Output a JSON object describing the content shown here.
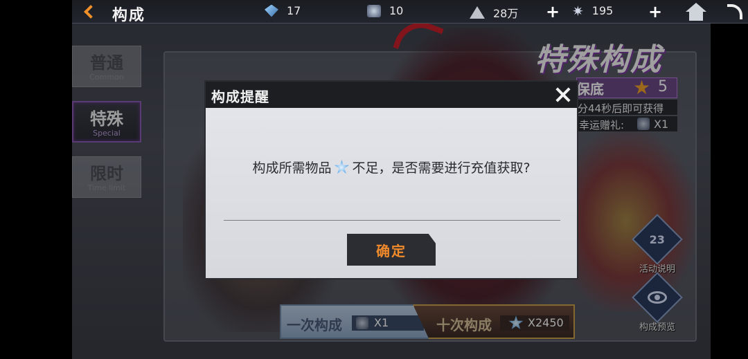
{
  "header": {
    "title": "构成",
    "resources": [
      {
        "icon": "gem-icon",
        "value": "17"
      },
      {
        "icon": "core-icon",
        "value": "10"
      },
      {
        "icon": "triangle-currency-icon",
        "value": "28万"
      },
      {
        "icon": "star-crystal-icon",
        "value": "195"
      }
    ]
  },
  "tabs": [
    {
      "zh": "普通",
      "en": "Common",
      "active": false
    },
    {
      "zh": "特殊",
      "en": "Special",
      "active": true
    },
    {
      "zh": "限时",
      "en": "Time limit",
      "active": false
    }
  ],
  "banner": {
    "title": "特殊构成",
    "pity_label": "保底",
    "pity_count": "5",
    "timer": "分44秒后即可获得",
    "gift_label": "幸运赠礼:",
    "gift_count": "X1"
  },
  "side_buttons": {
    "event_info": {
      "icon_text": "23",
      "label": "活动说明"
    },
    "preview": {
      "label": "构成预览"
    }
  },
  "pulls": {
    "single": {
      "label": "一次构成",
      "cost": "X1"
    },
    "ten": {
      "label": "十次构成",
      "cost": "X2450"
    }
  },
  "dialog": {
    "title": "构成提醒",
    "message_before": "构成所需物品",
    "message_after": "不足，是否需要进行充值获取?",
    "confirm_label": "确定"
  },
  "colors": {
    "accent_orange": "#f08a2a",
    "special_purple": "#8a5ab0",
    "dialog_header": "#1d1e22"
  }
}
